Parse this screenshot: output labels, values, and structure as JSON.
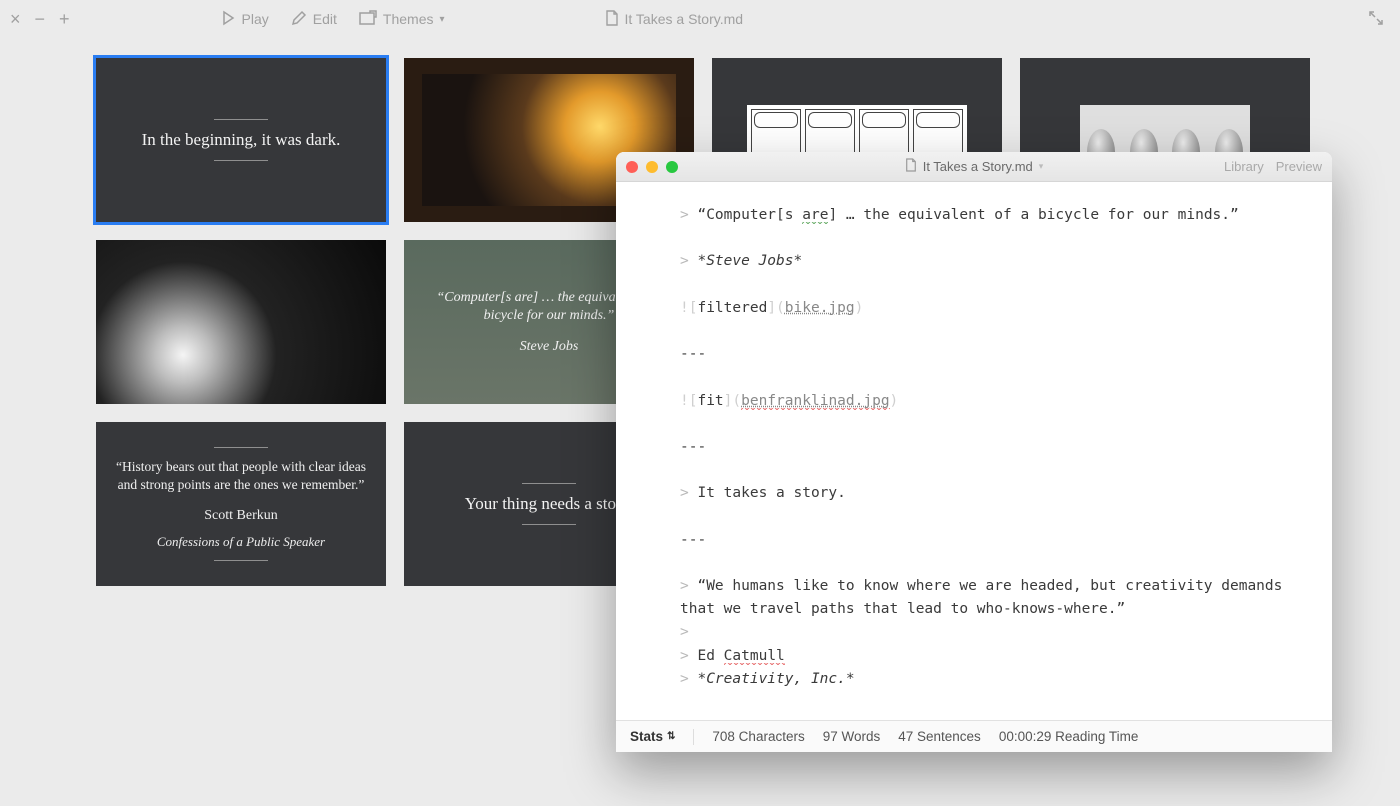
{
  "toolbar": {
    "play_label": "Play",
    "edit_label": "Edit",
    "themes_label": "Themes",
    "doc_title": "It Takes a Story.md"
  },
  "slides": [
    {
      "type": "title",
      "text": "In the beginning, it was dark.",
      "selected": true
    },
    {
      "type": "image",
      "variant": "movie"
    },
    {
      "type": "image",
      "variant": "comic"
    },
    {
      "type": "image",
      "variant": "bulbs"
    },
    {
      "type": "image",
      "variant": "portrait"
    },
    {
      "type": "quote",
      "variant": "bike",
      "quote": "“Computer[s are] … the equivalent of a bicycle for our minds.”",
      "author": "Steve Jobs"
    },
    {
      "type": "quote",
      "quote": "“We humans like to know where we are headed, but creativity demands that we travel paths that lead to who-knows-where.”",
      "author": "Ed Catmull",
      "source": "Creativity, Inc."
    },
    {
      "type": "image",
      "variant": "drawing"
    },
    {
      "type": "quote",
      "quote": "“History bears out that people with clear ideas and strong points are the ones we remember.”",
      "author": "Scott Berkun",
      "source": "Confessions of a Public Speaker"
    },
    {
      "type": "title",
      "text": "Your thing needs a story."
    }
  ],
  "editor": {
    "filename": "It Takes a Story.md",
    "library_label": "Library",
    "preview_label": "Preview",
    "text": {
      "q1a": "“Computer[s ",
      "q1b": "are",
      "q1c": "] … the equivalent of a bicycle for our minds.”",
      "attr1": "*Steve Jobs*",
      "img1_alt": "filtered",
      "img1_href": "bike.jpg",
      "hr": "---",
      "img2_alt": "fit",
      "img2_href": "benfranklinad.jpg",
      "q2": "It takes a story.",
      "q3": "“We humans like to know where we are headed, but creativity demands that we travel paths that lead to who-knows-where.”",
      "attr3a": "Ed ",
      "attr3b": "Catmull",
      "attr3c": "*Creativity, Inc.*"
    },
    "status": {
      "stats_label": "Stats",
      "characters": "708 Characters",
      "words": "97 Words",
      "sentences": "47 Sentences",
      "reading": "00:00:29 Reading Time"
    }
  }
}
